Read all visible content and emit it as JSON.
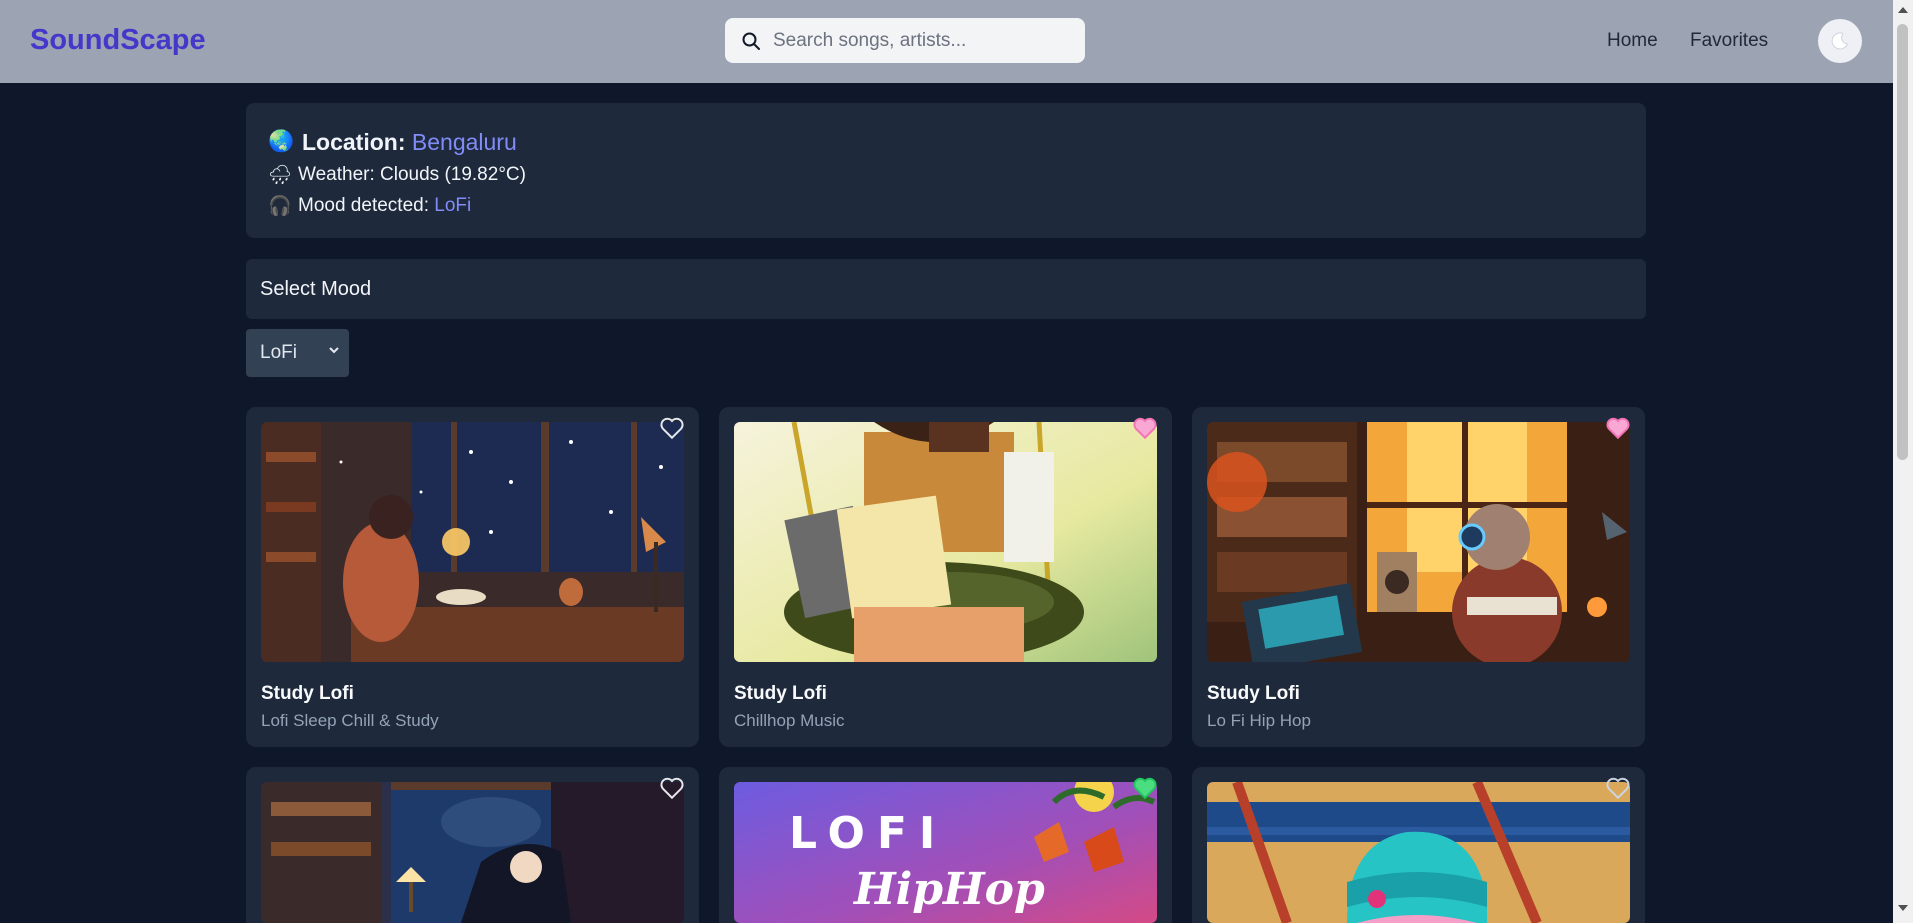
{
  "nav": {
    "brand": "SoundScape",
    "search_placeholder": "Search songs, artists...",
    "links": [
      "Home",
      "Favorites"
    ],
    "theme_icon": "moon-icon",
    "brand_color": "#4338ca",
    "bar_color": "#9ca3b2"
  },
  "info": {
    "location_label": "Location:",
    "location_value": "Bengaluru",
    "weather_text": "Weather: Clouds (19.82°C)",
    "mood_label": "Mood detected:",
    "mood_value": "LoFi",
    "globe_icon": "🌏",
    "weather_icon": "🌧",
    "mood_icon": "🎧"
  },
  "select": {
    "heading": "Select Mood",
    "value": "LoFi"
  },
  "cards": [
    {
      "title": "Study Lofi",
      "subtitle": "Lofi Sleep Chill & Study",
      "favorited": false
    },
    {
      "title": "Study Lofi",
      "subtitle": "Chillhop Music",
      "favorited": true
    },
    {
      "title": "Study Lofi",
      "subtitle": "Lo Fi Hip Hop",
      "favorited": true
    },
    {
      "title": "",
      "subtitle": "",
      "favorited": false
    },
    {
      "title": "",
      "subtitle": "",
      "favorited": true,
      "art_text_1": "LOFI",
      "art_text_2": "HipHop"
    },
    {
      "title": "",
      "subtitle": "",
      "favorited": false
    }
  ],
  "colors": {
    "page_bg": "#0f172a",
    "card_bg": "#1e293b",
    "accent": "#818cf8",
    "heart_fav": "#f472b6"
  }
}
